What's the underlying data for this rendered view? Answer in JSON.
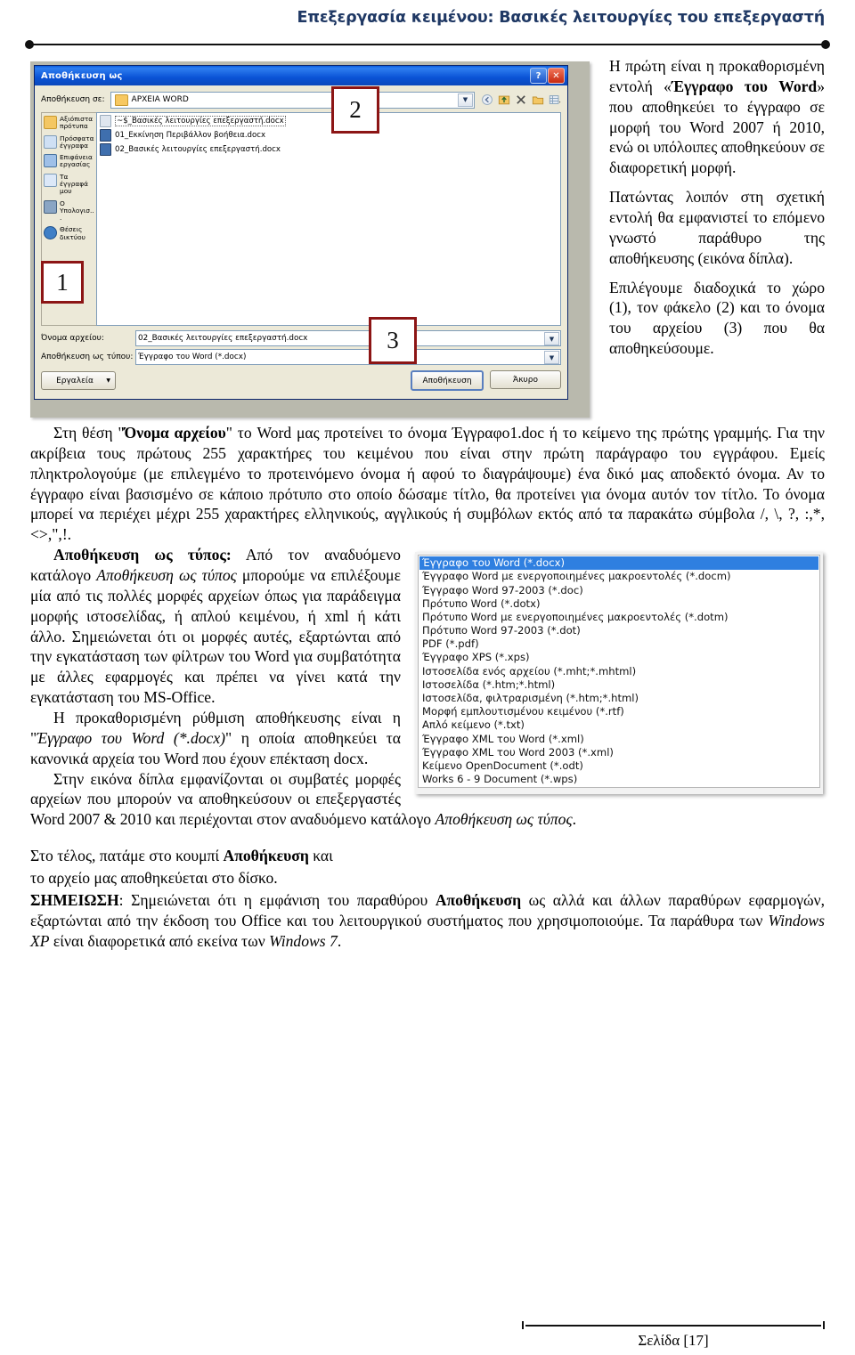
{
  "header": {
    "title": "Επεξεργασία κειμένου: Βασικές λειτουργίες του επεξεργαστή"
  },
  "dialog": {
    "title": "Αποθήκευση ως",
    "help_button": "?",
    "close_button": "✕",
    "save_in_label": "Αποθήκευση σε:",
    "save_in_value": "ΑΡΧΕΙΑ WORD",
    "toolbar_icons": [
      "back-icon",
      "up-one-level-icon",
      "delete-icon",
      "new-folder-icon",
      "views-icon"
    ],
    "places": [
      "Αξιόπιστα πρότυπα",
      "Πρόσφατα έγγραφα",
      "Επιφάνεια εργασίας",
      "Τα έγγραφά μου",
      "Ο Υπολογισ...",
      "Θέσεις δικτύου"
    ],
    "files": [
      "~$_Βασικές λειτουργίες επεξεργαστή.docx",
      "01_Εκκίνηση Περιβάλλον βοήθεια.docx",
      "02_Βασικές λειτουργίες επεξεργαστή.docx"
    ],
    "filename_label": "Όνομα αρχείου:",
    "filename_value": "02_Βασικές λειτουργίες επεξεργαστή.docx",
    "filetype_label": "Αποθήκευση ως τύπου:",
    "filetype_value": "Έγγραφο του Word (*.docx)",
    "tools_button": "Εργαλεία",
    "save_button": "Αποθήκευση",
    "cancel_button": "Άκυρο",
    "callouts": [
      "1",
      "2",
      "3"
    ]
  },
  "right_column": {
    "para1_a": "Η πρώτη είναι η προκαθορισμένη εντολή «",
    "para1_bold": "Έγγραφο του Word",
    "para1_b": "» που αποθηκεύει το έγγραφο σε μορφή του Word 2007 ή 2010, ενώ οι υπόλοιπες αποθηκεύουν σε διαφορετική μορφή.",
    "para2": "Πατώντας λοιπόν στη σχετική εντολή θα εμφανιστεί το επόμενο γνωστό παράθυρο της αποθήκευσης (εικόνα δίπλα).",
    "para3": "Επιλέγουμε διαδοχικά το χώρο (1), τον φάκελο (2) και το όνομα του αρχείου (3) που θα αποθηκεύσουμε."
  },
  "body": {
    "para_filename_a": "Στη θέση \"",
    "para_filename_bold": "Όνομα αρχείου",
    "para_filename_b": "\" το Word μας προτείνει το όνομα Έγγραφο1.doc ή το κείμενο της πρώτης γραμμής. Για την ακρίβεια τους πρώτους 255 χαρακτήρες του κειμένου που είναι στην πρώτη παράγραφο του εγγράφου.  Εμείς πληκτρολογούμε (με επιλεγμένο το προτεινόμενο όνομα ή αφού το διαγράψουμε) ένα δικό μας αποδεκτό όνομα. Αν το έγγραφο είναι βασισμένο σε κάποιο πρότυπο στο οποίο δώσαμε τίτλο, θα προτείνει για  όνομα αυτόν τον τίτλο. Το όνομα μπορεί να περιέχει μέχρι 255 χαρακτήρες ελληνικούς, αγγλικούς ή συμβόλων εκτός από τα παρακάτω σύμβολα /, \\, ?, :,*, <>,\",!.",
    "para_type_bold": "Αποθήκευση ως τύπος:",
    "para_type_a": "  Από τον αναδυόμενο κατάλογο ",
    "para_type_italic": "Αποθήκευση ως τύπος",
    "para_type_b": "  μπορούμε να επιλέξουμε μία από τις πολλές μορφές αρχείων όπως για παράδειγμα μορφής ιστοσελίδας, ή απλού κειμένου, ή xml ή κάτι άλλο. Σημειώνεται ότι οι μορφές αυτές, εξαρτώνται από την εγκατάσταση των φίλτρων του Word για συμβατότητα με άλλες εφαρμογές και πρέπει να γίνει κατά την εγκατάσταση του MS-Office.",
    "para_default_a": "Η προκαθορισμένη ρύθμιση αποθήκευσης είναι η \"",
    "para_default_italic": "Έγγραφο του Word (*.docx)",
    "para_default_b": "\" η οποία αποθηκεύει τα κανονικά αρχεία του Word που έχουν επέκταση docx.",
    "para_compat_a": "Στην εικόνα δίπλα εμφανίζονται οι συμβατές μορφές αρχείων που μπορούν να αποθηκεύσουν οι επεξεργαστές Word 2007 & 2010 και περιέχονται στον αναδυόμενο κατάλογο ",
    "para_compat_italic": "Αποθήκευση ως τύπος",
    "para_compat_b": ".",
    "para_end_a": "Στο τέλος, πατάμε στο κουμπί ",
    "para_end_bold": "Αποθήκευση",
    "para_end_b": " και",
    "para_end_line2": "το αρχείο μας αποθηκεύεται στο δίσκο.",
    "note_label": "ΣΗΜΕΙΩΣΗ",
    "note_a": ":  Σημειώνεται ότι η εμφάνιση του παραθύρου ",
    "note_bold": "Αποθήκευση",
    "note_b": " ως αλλά και άλλων παραθύρων εφαρμογών, εξαρτώνται από την έκδοση του Office και του λειτουργικού συστήματος που χρησιμοποιούμε. Τα παράθυρα των ",
    "note_italic1": "Windows XP",
    "note_c": " είναι διαφορετικά από εκείνα των ",
    "note_italic2": "Windows 7",
    "note_d": "."
  },
  "format_list": {
    "items": [
      "Έγγραφο του Word (*.docx)",
      "Έγγραφο Word με ενεργοποιημένες μακροεντολές (*.docm)",
      "Έγγραφο Word 97-2003 (*.doc)",
      "Πρότυπο Word (*.dotx)",
      "Πρότυπο Word με ενεργοποιημένες μακροεντολές (*.dotm)",
      "Πρότυπο Word 97-2003 (*.dot)",
      "PDF (*.pdf)",
      "Έγγραφο XPS (*.xps)",
      "Ιστοσελίδα ενός αρχείου (*.mht;*.mhtml)",
      "Ιστοσελίδα (*.htm;*.html)",
      "Ιστοσελίδα, φιλτραρισμένη (*.htm;*.html)",
      "Μορφή εμπλουτισμένου κειμένου (*.rtf)",
      "Απλό κείμενο (*.txt)",
      "Έγγραφο XML του Word (*.xml)",
      "Έγγραφο XML του Word 2003 (*.xml)",
      "Κείμενο OpenDocument (*.odt)",
      "Works 6 - 9 Document (*.wps)"
    ],
    "selected_index": 0
  },
  "footer": {
    "page_label": "Σελίδα [17]"
  },
  "colors": {
    "header_blue": "#1F3864",
    "callout_red": "#8c1515",
    "selection_blue": "#2f7fe0",
    "titlebar_blue": "#0a53d6"
  }
}
